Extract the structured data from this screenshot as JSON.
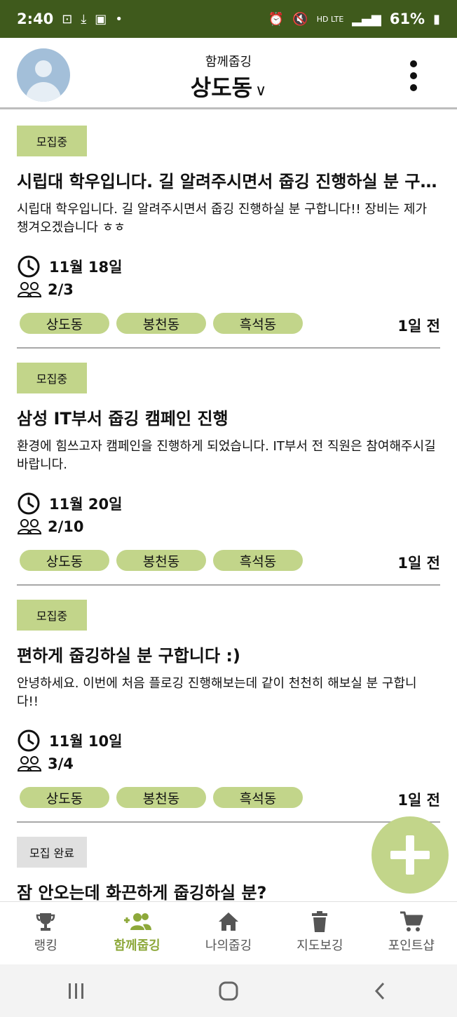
{
  "status_bar": {
    "time": "2:40",
    "battery": "61%",
    "network": "HD LTE"
  },
  "header": {
    "subtitle": "함께줍깅",
    "title": "상도동",
    "chevron": "∨"
  },
  "posts": [
    {
      "status": "모집중",
      "title": "시립대 학우입니다. 길 알려주시면서 줍깅 진행하실 분 구합니다!!",
      "body": "시립대 학우입니다. 길 알려주시면서 줍깅 진행하실 분 구합니다!! 장비는 제가 챙겨오겠습니다 ㅎㅎ",
      "date": "11월 18일",
      "people": "2/3",
      "tags": [
        "상도동",
        "봉천동",
        "흑석동"
      ],
      "time_ago": "1일 전"
    },
    {
      "status": "모집중",
      "title": "삼성 IT부서 줍깅 캠페인 진행",
      "body": "환경에 힘쓰고자 캠페인을 진행하게 되었습니다. IT부서 전 직원은 참여해주시길 바랍니다.",
      "date": "11월 20일",
      "people": "2/10",
      "tags": [
        "상도동",
        "봉천동",
        "흑석동"
      ],
      "time_ago": "1일 전"
    },
    {
      "status": "모집중",
      "title": "편하게 줍깅하실 분 구합니다 :)",
      "body": "안녕하세요. 이번에 처음 플로깅 진행해보는데 같이 천천히 해보실 분 구합니다!!",
      "date": "11월 10일",
      "people": "3/4",
      "tags": [
        "상도동",
        "봉천동",
        "흑석동"
      ],
      "time_ago": "1일 전"
    },
    {
      "status": "모집 완료",
      "title": "잠 안오는데 화끈하게 줍깅하실 분?"
    }
  ],
  "bottom_nav": [
    {
      "label": "랭킹",
      "icon": "trophy-icon"
    },
    {
      "label": "함께줍깅",
      "icon": "add-group-icon",
      "active": true
    },
    {
      "label": "나의줍깅",
      "icon": "home-icon"
    },
    {
      "label": "지도보깅",
      "icon": "trash-icon"
    },
    {
      "label": "포인트샵",
      "icon": "cart-icon"
    }
  ],
  "colors": {
    "status_bar": "#3f5a1c",
    "accent": "#c2d58a",
    "active_nav": "#8da83a",
    "done_badge": "#e0e0e0"
  }
}
